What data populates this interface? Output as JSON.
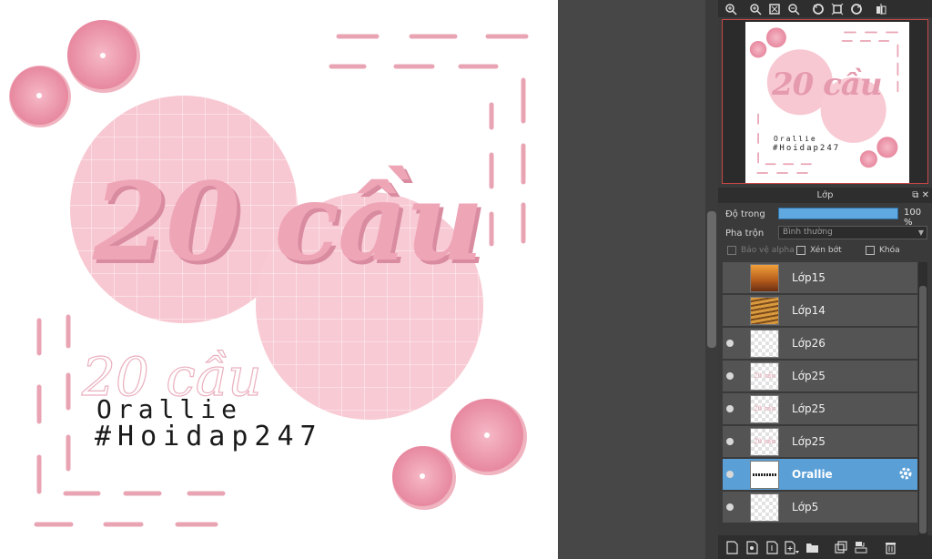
{
  "artwork": {
    "big_title": "20 cầu",
    "small_title": "20 cầu",
    "author": "Orallie",
    "hashtag": "#Hoidap247"
  },
  "nav_toolbar": {
    "icons": [
      "zoom-fit-icon",
      "zoom-in-icon",
      "fit-window-icon",
      "zoom-out-icon",
      "rotate-left-icon",
      "actual-size-icon",
      "rotate-right-icon",
      "flip-icon"
    ]
  },
  "layers_panel": {
    "title": "Lớp",
    "opacity_label": "Độ trong",
    "opacity_value": "100 %",
    "opacity_fraction": 1.0,
    "blend_label": "Pha trộn",
    "blend_value": "Bình thường",
    "protect_alpha_label": "Bảo vệ alpha",
    "clipping_label": "Xén bớt",
    "lock_label": "Khóa",
    "layers": [
      {
        "name": "Lớp15",
        "visible": false,
        "thumb": "photo1",
        "selected": false
      },
      {
        "name": "Lớp14",
        "visible": false,
        "thumb": "photo2",
        "selected": false
      },
      {
        "name": "Lớp26",
        "visible": true,
        "thumb": "empty",
        "selected": false
      },
      {
        "name": "Lớp25",
        "visible": true,
        "thumb": "text",
        "selected": false
      },
      {
        "name": "Lớp25",
        "visible": true,
        "thumb": "text",
        "selected": false
      },
      {
        "name": "Lớp25",
        "visible": true,
        "thumb": "text",
        "selected": false
      },
      {
        "name": "Orallie",
        "visible": true,
        "thumb": "strip",
        "selected": true
      },
      {
        "name": "Lớp5",
        "visible": true,
        "thumb": "empty",
        "selected": false
      }
    ]
  },
  "colors": {
    "accent_blue": "#5a9fd6",
    "pink": "#f3c6d0",
    "pink_dark": "#e49aad"
  }
}
